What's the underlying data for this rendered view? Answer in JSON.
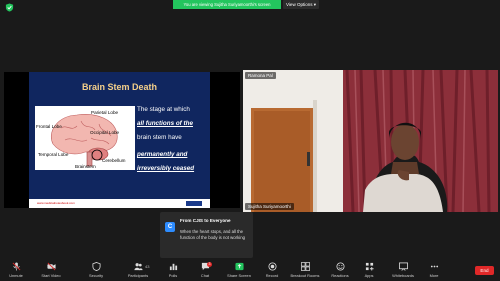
{
  "meeting": {
    "banner": "You are viewing Sujitha Suriyamoorthi's screen",
    "view_options": "View Options",
    "colors": {
      "banner": "#23c55e",
      "end": "#e02828",
      "accent": "#2d8cff"
    }
  },
  "slide": {
    "title": "Brain Stem Death",
    "lines": [
      "The stage at which",
      "all functions of the",
      "brain stem have",
      "permanently and",
      "irreversibly ceased"
    ],
    "diagram_labels": {
      "parietal": "Parietal Lobe",
      "frontal": "Frontal Lobe",
      "occipital": "Occipital Lobe",
      "temporal": "Temporal Lobe",
      "cerebellum": "Cerebellum",
      "brainstem": "Brainstem"
    },
    "footer_url": "www.medicalnotesbook.com"
  },
  "video": {
    "top_name": "Ramona Pal",
    "bottom_name": "Sujitha Suriyamoorthi"
  },
  "chat": {
    "avatar_letter": "C",
    "from": "From CJIS to Everyone",
    "message": "When the heart stops, and all the function of the body is not working"
  },
  "toolbar": {
    "unmute": "Unmute",
    "start_video": "Start Video",
    "security": "Security",
    "participants": "Participants",
    "participants_count": "43",
    "polls": "Polls",
    "chat": "Chat",
    "chat_badge": "3",
    "share_screen": "Share Screen",
    "record": "Record",
    "breakout_rooms": "Breakout Rooms",
    "reactions": "Reactions",
    "apps": "Apps",
    "whiteboards": "Whiteboards",
    "more": "More",
    "end": "End"
  }
}
